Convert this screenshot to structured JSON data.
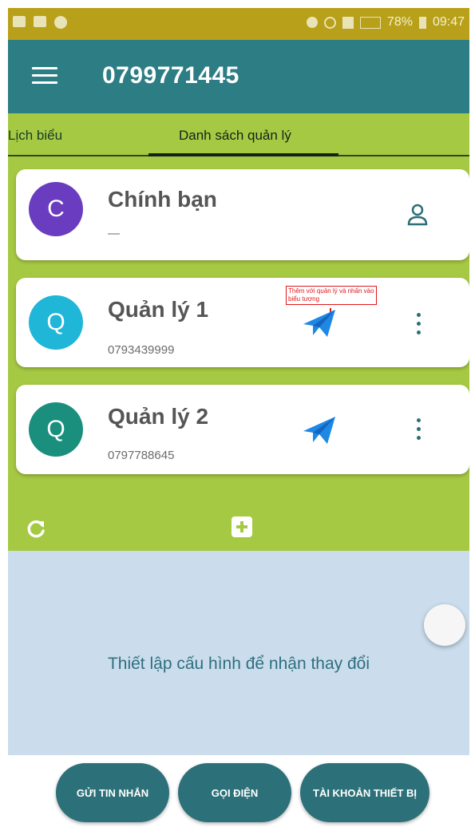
{
  "status_bar": {
    "battery": "78%",
    "time": "09:47"
  },
  "app_bar": {
    "title": "0799771445"
  },
  "tabs": [
    {
      "label": "Lịch biểu"
    },
    {
      "label": "Danh sách quản lý"
    }
  ],
  "contacts": [
    {
      "initial": "C",
      "name": "Chính bạn",
      "subtitle": "—",
      "avatar_color": "#6a3cbf"
    },
    {
      "initial": "Q",
      "name": "Quản lý 1",
      "subtitle": "0793439999",
      "avatar_color": "#1fb6d8"
    },
    {
      "initial": "Q",
      "name": "Quản lý 2",
      "subtitle": "0797788645",
      "avatar_color": "#1a8f7e"
    }
  ],
  "annotation": {
    "text": "Thêm với quản lý và nhấn vào biểu tượng"
  },
  "config_message": "Thiết lập cấu hình để nhận thay đổi",
  "bottom_buttons": [
    {
      "label": "GỬI TIN NHẮN"
    },
    {
      "label": "GỌI ĐIỆN"
    },
    {
      "label": "TÀI KHOẢN THIẾT BỊ"
    }
  ],
  "colors": {
    "status_bar": "#b9a01a",
    "app_bar": "#2c7d84",
    "content_green": "#a6c943",
    "send_icon": "#1e88e5",
    "lower_panel": "#cbdded",
    "button": "#2c7179"
  },
  "icons": [
    "menu-icon",
    "person-icon",
    "send-icon",
    "more-vert-icon",
    "refresh-icon",
    "add-icon"
  ]
}
